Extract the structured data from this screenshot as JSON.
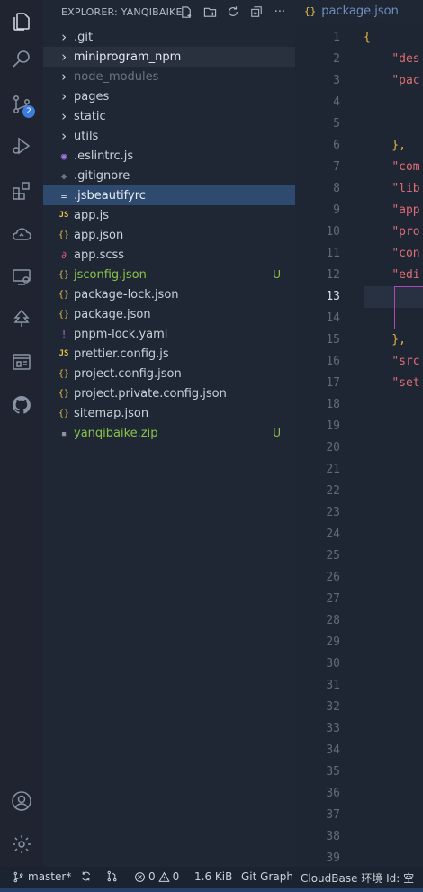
{
  "activity_bar": {
    "items": [
      {
        "icon": "files-icon"
      },
      {
        "icon": "search-icon"
      },
      {
        "icon": "source-control-icon",
        "badge": "2"
      },
      {
        "icon": "run-debug-icon"
      },
      {
        "icon": "extensions-icon"
      },
      {
        "icon": "cloud-icon"
      },
      {
        "icon": "remote-explorer-icon"
      },
      {
        "icon": "tree-icon"
      },
      {
        "icon": "browser-preview-icon"
      },
      {
        "icon": "github-icon"
      }
    ],
    "bottom": [
      {
        "icon": "account-icon"
      },
      {
        "icon": "settings-gear-icon"
      }
    ]
  },
  "explorer": {
    "title": "EXPLORER: YANQIBAIKE",
    "actions": [
      "new-file-icon",
      "new-folder-icon",
      "refresh-icon",
      "collapse-icon",
      "more-icon"
    ],
    "items": [
      {
        "label": ".git",
        "kind": "folder",
        "color": "#c9d1d9"
      },
      {
        "label": "miniprogram_npm",
        "kind": "folder",
        "color": "#e6ebf2"
      },
      {
        "label": "node_modules",
        "kind": "folder",
        "color": "#6b7586"
      },
      {
        "label": "pages",
        "kind": "folder",
        "color": "#c9d1d9"
      },
      {
        "label": "static",
        "kind": "folder",
        "color": "#c9d1d9"
      },
      {
        "label": "utils",
        "kind": "folder",
        "color": "#c9d1d9"
      },
      {
        "label": ".eslintrc.js",
        "kind": "eslint",
        "color": "#c9d1d9"
      },
      {
        "label": ".gitignore",
        "kind": "git",
        "color": "#c9d1d9"
      },
      {
        "label": ".jsbeautifyrc",
        "kind": "lines",
        "color": "#e6ebf2"
      },
      {
        "label": "app.js",
        "kind": "js",
        "color": "#c9d1d9"
      },
      {
        "label": "app.json",
        "kind": "json",
        "color": "#c9d1d9"
      },
      {
        "label": "app.scss",
        "kind": "scss",
        "color": "#c9d1d9"
      },
      {
        "label": "jsconfig.json",
        "kind": "json",
        "color": "#8bc34a",
        "status": "U"
      },
      {
        "label": "package-lock.json",
        "kind": "json",
        "color": "#c9d1d9"
      },
      {
        "label": "package.json",
        "kind": "json",
        "color": "#c9d1d9"
      },
      {
        "label": "pnpm-lock.yaml",
        "kind": "yaml",
        "color": "#c9d1d9"
      },
      {
        "label": "prettier.config.js",
        "kind": "js",
        "color": "#c9d1d9"
      },
      {
        "label": "project.config.json",
        "kind": "json",
        "color": "#c9d1d9"
      },
      {
        "label": "project.private.config.json",
        "kind": "json",
        "color": "#c9d1d9"
      },
      {
        "label": "sitemap.json",
        "kind": "json",
        "color": "#c9d1d9"
      },
      {
        "label": "yanqibaike.zip",
        "kind": "zip",
        "color": "#8bc34a",
        "status": "U"
      }
    ]
  },
  "editor": {
    "tab": {
      "label": "package.json"
    },
    "active_line": 13,
    "line_numbers": [
      "1",
      "2",
      "3",
      "4",
      "5",
      "6",
      "7",
      "8",
      "9",
      "10",
      "11",
      "12",
      "13",
      "14",
      "15",
      "16",
      "17",
      "18",
      "19",
      "20",
      "21",
      "22",
      "23",
      "24",
      "25",
      "26",
      "27",
      "28",
      "29",
      "30",
      "31",
      "32",
      "33",
      "34",
      "35",
      "36",
      "37",
      "38",
      "39"
    ],
    "lines": [
      {
        "text": "{",
        "str": ""
      },
      {
        "text": "    ",
        "str": "\"des"
      },
      {
        "text": "    ",
        "str": "\"pac"
      },
      {
        "text": "",
        "str": ""
      },
      {
        "text": "",
        "str": ""
      },
      {
        "text": "    },",
        "str": ""
      },
      {
        "text": "    ",
        "str": "\"com"
      },
      {
        "text": "    ",
        "str": "\"lib"
      },
      {
        "text": "    ",
        "str": "\"app"
      },
      {
        "text": "    ",
        "str": "\"pro"
      },
      {
        "text": "    ",
        "str": "\"con"
      },
      {
        "text": "    ",
        "str": "\"edi"
      },
      {
        "text": "",
        "str": ""
      },
      {
        "text": "",
        "str": ""
      },
      {
        "text": "    },",
        "str": ""
      },
      {
        "text": "    ",
        "str": "\"src"
      },
      {
        "text": "    ",
        "str": "\"set"
      }
    ]
  },
  "status_bar": {
    "branch": "master*",
    "errors": "0",
    "warnings": "0",
    "size": "1.6 KiB",
    "git_graph": "Git Graph",
    "cloudbase": "CloudBase 环境 Id: 空"
  },
  "colors": {
    "accent": "#3b7ddd",
    "untracked": "#8bc34a",
    "selected_row": "#2f4a6f"
  }
}
